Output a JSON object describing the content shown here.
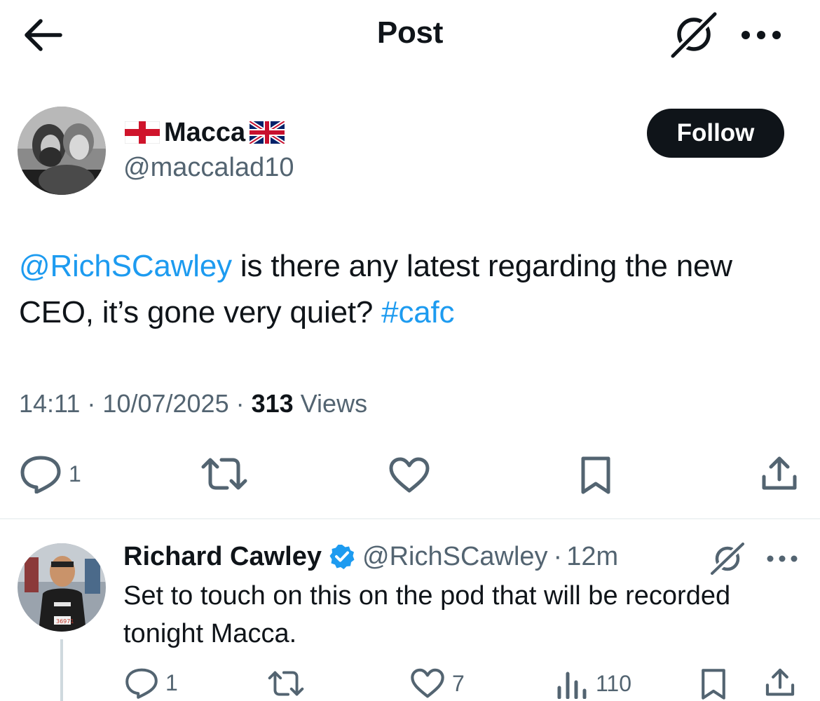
{
  "header": {
    "title": "Post",
    "back_icon": "arrow-left-icon",
    "grok_icon": "grok-icon",
    "more_icon": "more-horizontal-icon"
  },
  "post": {
    "author_name": "Macca",
    "author_flag_left": "england-flag",
    "author_flag_right": "uk-flag",
    "author_handle": "@maccalad10",
    "follow_label": "Follow",
    "text": {
      "mention": "@RichSCawley",
      "body": " is there any latest regarding the new CEO, it’s gone very quiet? ",
      "hashtag": "#cafc"
    },
    "meta": {
      "time": "14:11",
      "sep1": " · ",
      "date": "10/07/2025",
      "sep2": " · ",
      "views_count": "313",
      "views_label": " Views"
    },
    "actions": {
      "reply_count": "1",
      "reply_icon": "reply-icon",
      "repost_icon": "repost-icon",
      "like_icon": "heart-icon",
      "bookmark_icon": "bookmark-icon",
      "share_icon": "share-icon"
    }
  },
  "reply": {
    "author_name": "Richard Cawley",
    "verified_icon": "verified-badge-icon",
    "author_handle": "@RichSCawley",
    "sep": "·",
    "time": "12m",
    "text": "Set to touch on this on the pod that will be recorded tonight Macca.",
    "actions": {
      "reply_count": "1",
      "like_count": "7",
      "views_count": "110"
    }
  },
  "colors": {
    "link": "#1d9bf0",
    "text": "#0f1419",
    "secondary": "#536471",
    "verified": "#1d9bf0",
    "follow_bg": "#0f1419"
  }
}
